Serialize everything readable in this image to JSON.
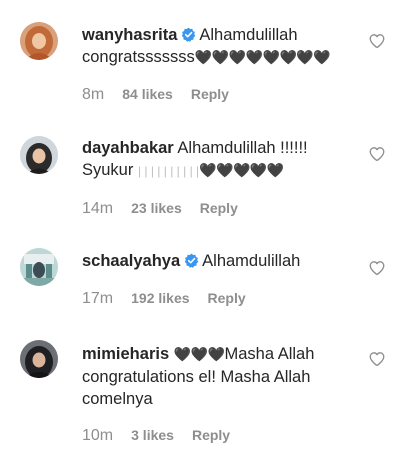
{
  "comments": [
    {
      "username": "wanyhasrita",
      "verified": true,
      "text_line1": "Alhamdulillah",
      "text_line2": "congratsssssss",
      "hearts": "🖤🖤🖤🖤🖤🖤🖤🖤",
      "time": "8m",
      "likes": "84 likes",
      "reply": "Reply",
      "like_icon": "heart-outline-icon"
    },
    {
      "username": "dayahbakar",
      "verified": false,
      "text_line1": "Alhamdulillah !!!!!!",
      "text_line2": "Syukur",
      "ticks": "| | | | | | | | | |",
      "hearts": "🖤🖤🖤🖤🖤",
      "time": "14m",
      "likes": "23 likes",
      "reply": "Reply",
      "like_icon": "heart-outline-icon"
    },
    {
      "username": "schaalyahya",
      "verified": true,
      "text_line1": "Alhamdulillah",
      "time": "17m",
      "likes": "192 likes",
      "reply": "Reply",
      "like_icon": "heart-outline-icon"
    },
    {
      "username": "mimieharis",
      "verified": false,
      "hearts": "🖤🖤🖤",
      "text_line1": "Masha Allah",
      "text_line2": "congratulations el! Masha Allah",
      "text_line3": "comelnya",
      "time": "10m",
      "likes": "3 likes",
      "reply": "Reply",
      "like_icon": "heart-outline-icon"
    }
  ],
  "colors": {
    "text": "#262626",
    "meta": "#8e8e8e",
    "verified_blue": "#3897f0"
  }
}
